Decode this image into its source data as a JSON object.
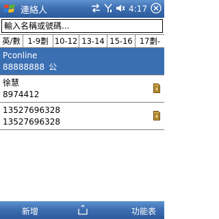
{
  "titlebar": {
    "title": "連絡人",
    "time": "4:17",
    "icons": [
      "windows-start-icon",
      "connectivity-icon",
      "signal-icon",
      "volume-icon",
      "close-icon"
    ]
  },
  "search": {
    "placeholder": "輸入名稱或號碼..."
  },
  "tabs": [
    {
      "label": "英/數"
    },
    {
      "label": "1-9劃"
    },
    {
      "label": "10-12"
    },
    {
      "label": "13-14"
    },
    {
      "label": "15-16"
    },
    {
      "label": "17劃-"
    }
  ],
  "contacts": [
    {
      "line1": "Pconline",
      "line2": "88888888",
      "tag": "公",
      "selected": true,
      "has_sim_icon": false
    },
    {
      "line1": "徐慧",
      "line2": "8974412",
      "tag": "",
      "selected": false,
      "has_sim_icon": true
    },
    {
      "line1": "13527696328",
      "line2": "13527696328",
      "tag": "",
      "selected": false,
      "has_sim_icon": true
    }
  ],
  "bottombar": {
    "left_softkey": "新增",
    "right_softkey": "功能表"
  },
  "colors": {
    "bar_blue": "#3e6fb2",
    "selection_blue": "#3b6fb3"
  }
}
